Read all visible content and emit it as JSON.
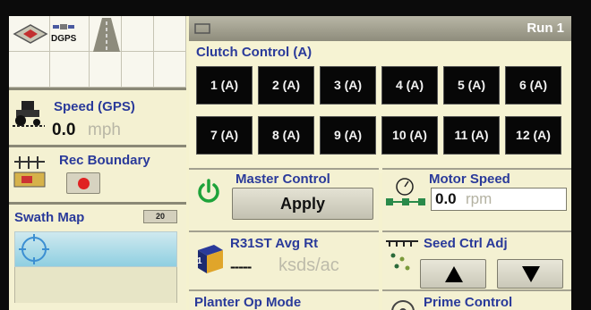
{
  "left_panel": {
    "gps_label": "DGPS",
    "speed": {
      "title": "Speed (GPS)",
      "value": "0.0",
      "unit": "mph"
    },
    "boundary": {
      "title": "Rec Boundary"
    },
    "swath": {
      "title": "Swath Map",
      "badge": "20"
    }
  },
  "header": {
    "run_label": "Run 1"
  },
  "clutch": {
    "title": "Clutch Control (A)",
    "buttons": [
      "1 (A)",
      "2 (A)",
      "3 (A)",
      "4 (A)",
      "5 (A)",
      "6 (A)",
      "7 (A)",
      "8 (A)",
      "9 (A)",
      "10 (A)",
      "11 (A)",
      "12 (A)"
    ]
  },
  "master": {
    "title": "Master Control",
    "apply_label": "Apply"
  },
  "motor": {
    "title": "Motor Speed",
    "value": "0.0",
    "unit": "rpm"
  },
  "avg_rate": {
    "title": "R31ST Avg Rt",
    "value": "-----",
    "unit": "ksds/ac",
    "badge": "1"
  },
  "seed_ctrl": {
    "title": "Seed Ctrl Adj"
  },
  "planter": {
    "title": "Planter Op Mode"
  },
  "prime": {
    "title": "Prime Control"
  },
  "colors": {
    "accent_text": "#2a3a9a",
    "background": "#f5f2cf",
    "clutch_button": "#070707",
    "record": "#e02222",
    "power": "#1ea33a"
  }
}
